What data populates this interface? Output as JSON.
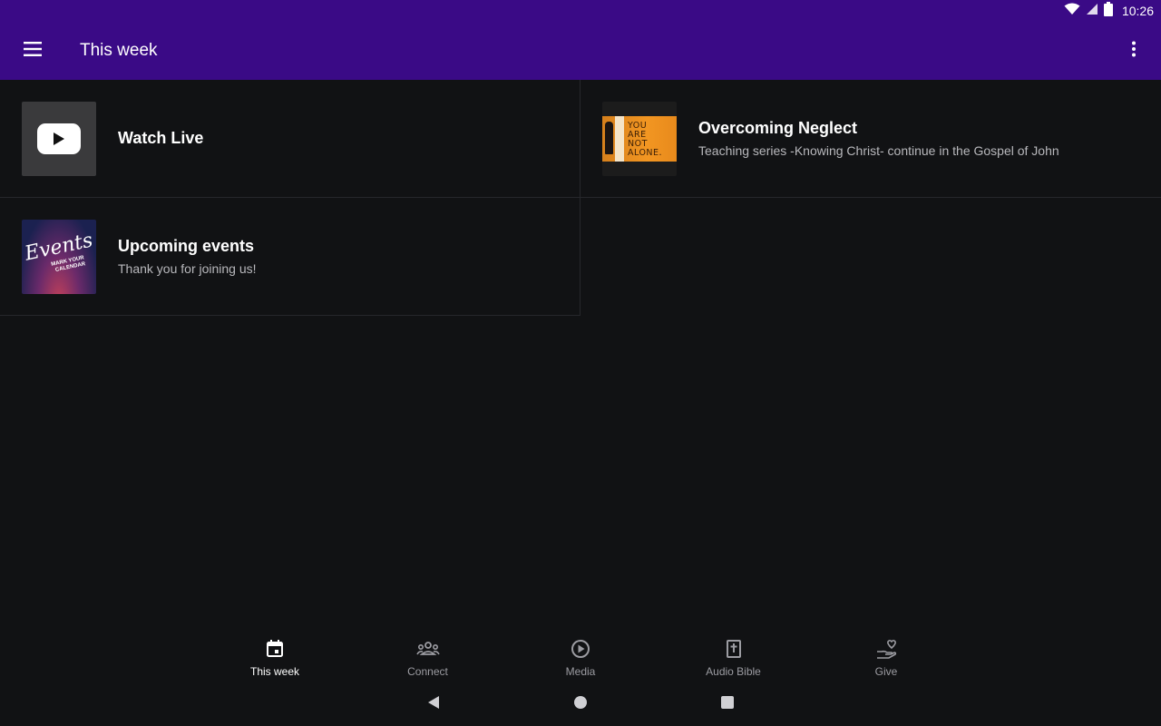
{
  "status_bar": {
    "time": "10:26",
    "icons": [
      "wifi-icon",
      "signal-icon",
      "battery-icon"
    ]
  },
  "app_bar": {
    "title": "This week",
    "menu_icon": "hamburger-menu-icon",
    "overflow_icon": "more-vert-icon"
  },
  "cards": [
    {
      "title": "Watch Live",
      "subtitle": "",
      "thumb": "youtube-play"
    },
    {
      "title": "Overcoming Neglect",
      "subtitle": "Teaching series -Knowing Christ- continue in the Gospel of John",
      "thumb_text": [
        "YOU",
        "ARE",
        "NOT",
        "ALONE."
      ]
    },
    {
      "title": "Upcoming events",
      "subtitle": "Thank you for joining us!",
      "thumb_text": [
        "Events",
        "MARK YOUR",
        "CALENDAR"
      ]
    }
  ],
  "bottom_nav": [
    {
      "label": "This week",
      "icon": "calendar-icon",
      "active": true
    },
    {
      "label": "Connect",
      "icon": "people-icon",
      "active": false
    },
    {
      "label": "Media",
      "icon": "play-circle-icon",
      "active": false
    },
    {
      "label": "Audio Bible",
      "icon": "bible-icon",
      "active": false
    },
    {
      "label": "Give",
      "icon": "hand-heart-icon",
      "active": false
    }
  ],
  "colors": {
    "primary": "#3a0a86",
    "background": "#111214",
    "divider": "#26272b",
    "inactive_nav": "#9c9ca2"
  }
}
